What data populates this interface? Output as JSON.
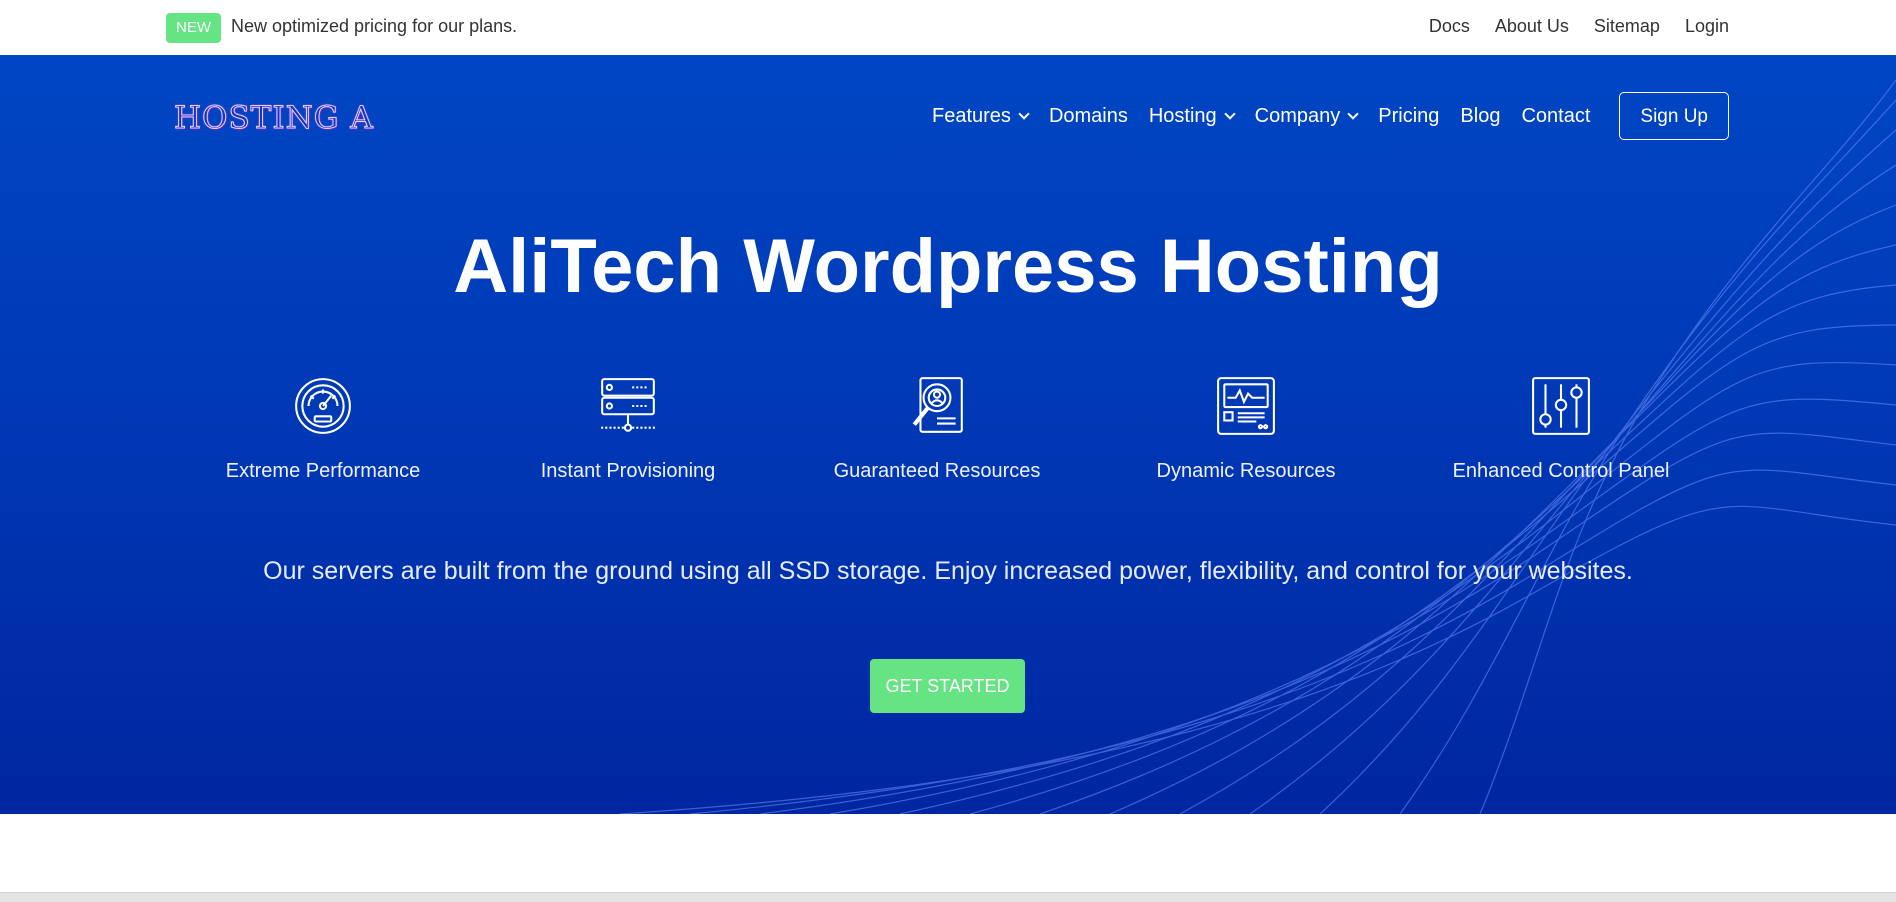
{
  "topbar": {
    "badge": "NEW",
    "announcement": "New optimized pricing for our plans.",
    "links": [
      "Docs",
      "About Us",
      "Sitemap",
      "Login"
    ]
  },
  "header": {
    "logo_text": "HOSTING A",
    "nav": [
      {
        "label": "Features",
        "dropdown": true
      },
      {
        "label": "Domains",
        "dropdown": false
      },
      {
        "label": "Hosting",
        "dropdown": true
      },
      {
        "label": "Company",
        "dropdown": true
      },
      {
        "label": "Pricing",
        "dropdown": false
      },
      {
        "label": "Blog",
        "dropdown": false
      },
      {
        "label": "Contact",
        "dropdown": false
      }
    ],
    "signup_label": "Sign Up"
  },
  "hero": {
    "title": "AliTech Wordpress Hosting",
    "features": [
      {
        "label": "Extreme Performance",
        "icon": "speedometer-icon"
      },
      {
        "label": "Instant Provisioning",
        "icon": "server-icon"
      },
      {
        "label": "Guaranteed Resources",
        "icon": "search-document-icon"
      },
      {
        "label": "Dynamic Resources",
        "icon": "monitor-chart-icon"
      },
      {
        "label": "Enhanced Control Panel",
        "icon": "sliders-icon"
      }
    ],
    "tagline": "Our servers are built from the ground using all SSD storage. Enjoy increased power, flexibility, and control for your websites.",
    "cta_label": "GET STARTED"
  },
  "colors": {
    "hero_top": "#0046c4",
    "hero_bottom": "#0026a0",
    "accent_green": "#66e383",
    "wave_lines": "#6f8cff"
  }
}
